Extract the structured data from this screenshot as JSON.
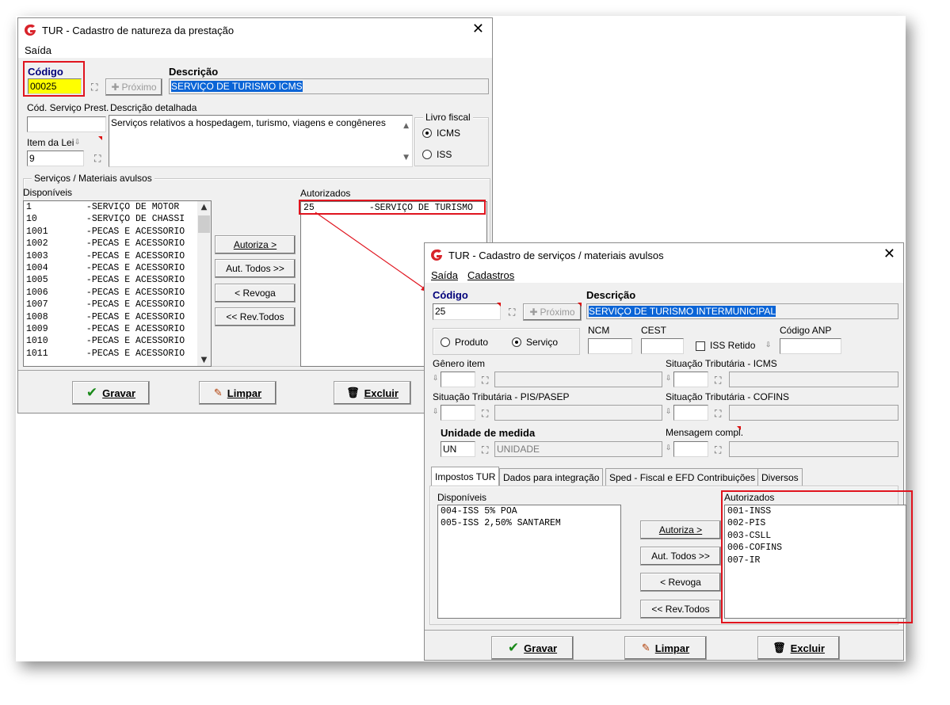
{
  "win1": {
    "title": "TUR - Cadastro de natureza da prestação",
    "menu": [
      "Saída"
    ],
    "codigo_label": "Código",
    "codigo_value": "00025",
    "proximo_label": "Próximo",
    "descricao_label": "Descrição",
    "descricao_value": "SERVIÇO DE TURISMO ICMS",
    "cod_servico_label": "Cód. Serviço Prest.",
    "cod_servico_value": "",
    "descricao_detalhada_label": "Descrição detalhada",
    "descricao_detalhada_value": "Serviços relativos a hospedagem, turismo, viagens e congêneres",
    "item_lei_label": "Item da Lei",
    "item_lei_value": "9",
    "livro_fiscal_label": "Livro fiscal",
    "livro_fiscal_options": [
      "ICMS",
      "ISS"
    ],
    "livro_fiscal_selected": "ICMS",
    "servicos_group": "Serviços  /  Materiais avulsos",
    "disponiveis_label": "Disponíveis",
    "autorizados_label": "Autorizados",
    "disponiveis": [
      "1          -SERVIÇO DE MOTOR",
      "10         -SERVIÇO DE CHASSI",
      "1001       -PECAS E ACESSORIO",
      "1002       -PECAS E ACESSORIO",
      "1003       -PECAS E ACESSORIO",
      "1004       -PECAS E ACESSORIO",
      "1005       -PECAS E ACESSORIO",
      "1006       -PECAS E ACESSORIO",
      "1007       -PECAS E ACESSORIO",
      "1008       -PECAS E ACESSORIO",
      "1009       -PECAS E ACESSORIO",
      "1010       -PECAS E ACESSORIO",
      "1011       -PECAS E ACESSORIO"
    ],
    "autorizados": [
      "25          -SERVIÇO DE TURISMO"
    ],
    "buttons": {
      "autoriza": "Autoriza >",
      "aut_todos": "Aut. Todos >>",
      "revoga": "< Revoga",
      "rev_todos": "<< Rev.Todos"
    },
    "footer": {
      "gravar": "Gravar",
      "limpar": "Limpar",
      "excluir": "Excluir"
    }
  },
  "win2": {
    "title": "TUR - Cadastro de serviços / materiais avulsos",
    "menu": [
      "Saída",
      "Cadastros"
    ],
    "codigo_label": "Código",
    "codigo_value": "25",
    "proximo_label": "Próximo",
    "descricao_label": "Descrição",
    "descricao_value": "SERVIÇO DE TURISMO INTERMUNICIPAL",
    "tipo_options": [
      "Produto",
      "Serviço"
    ],
    "tipo_selected": "Serviço",
    "ncm_label": "NCM",
    "ncm_value": "",
    "cest_label": "CEST",
    "cest_value": "",
    "iss_retido_label": "ISS Retido",
    "iss_retido_checked": false,
    "codigo_anp_label": "Código ANP",
    "codigo_anp_value": "",
    "genero_item_label": "Gênero item",
    "sit_icms_label": "Situação Tributária - ICMS",
    "sit_pis_label": "Situação Tributária - PIS/PASEP",
    "sit_cofins_label": "Situação Tributária - COFINS",
    "unidade_label": "Unidade de medida",
    "unidade_code": "UN",
    "unidade_desc": "UNIDADE",
    "mensagem_label": "Mensagem compl.",
    "tabs": [
      "Impostos TUR",
      "Dados para integração",
      "Sped - Fiscal e EFD Contribuições",
      "Diversos"
    ],
    "active_tab": "Impostos TUR",
    "disponiveis_label": "Disponíveis",
    "autorizados_label": "Autorizados",
    "disponiveis": [
      "004-ISS 5% POA",
      "005-ISS 2,50% SANTAREM"
    ],
    "autorizados": [
      "001-INSS",
      "002-PIS",
      "003-CSLL",
      "006-COFINS",
      "007-IR"
    ],
    "buttons": {
      "autoriza": "Autoriza >",
      "aut_todos": "Aut. Todos >>",
      "revoga": "< Revoga",
      "rev_todos": "<< Rev.Todos"
    },
    "footer": {
      "gravar": "Gravar",
      "limpar": "Limpar",
      "excluir": "Excluir"
    }
  },
  "colors": {
    "highlight": "#ffff00",
    "selection": "#0a64d6",
    "callout_red": "#e0141e",
    "label_blue": "#00007a"
  },
  "icons": [
    "tur-logo-icon",
    "close-icon",
    "binoculars-icon",
    "plus-icon",
    "dropdown-icon",
    "check-icon",
    "pencil-icon",
    "trash-icon"
  ]
}
